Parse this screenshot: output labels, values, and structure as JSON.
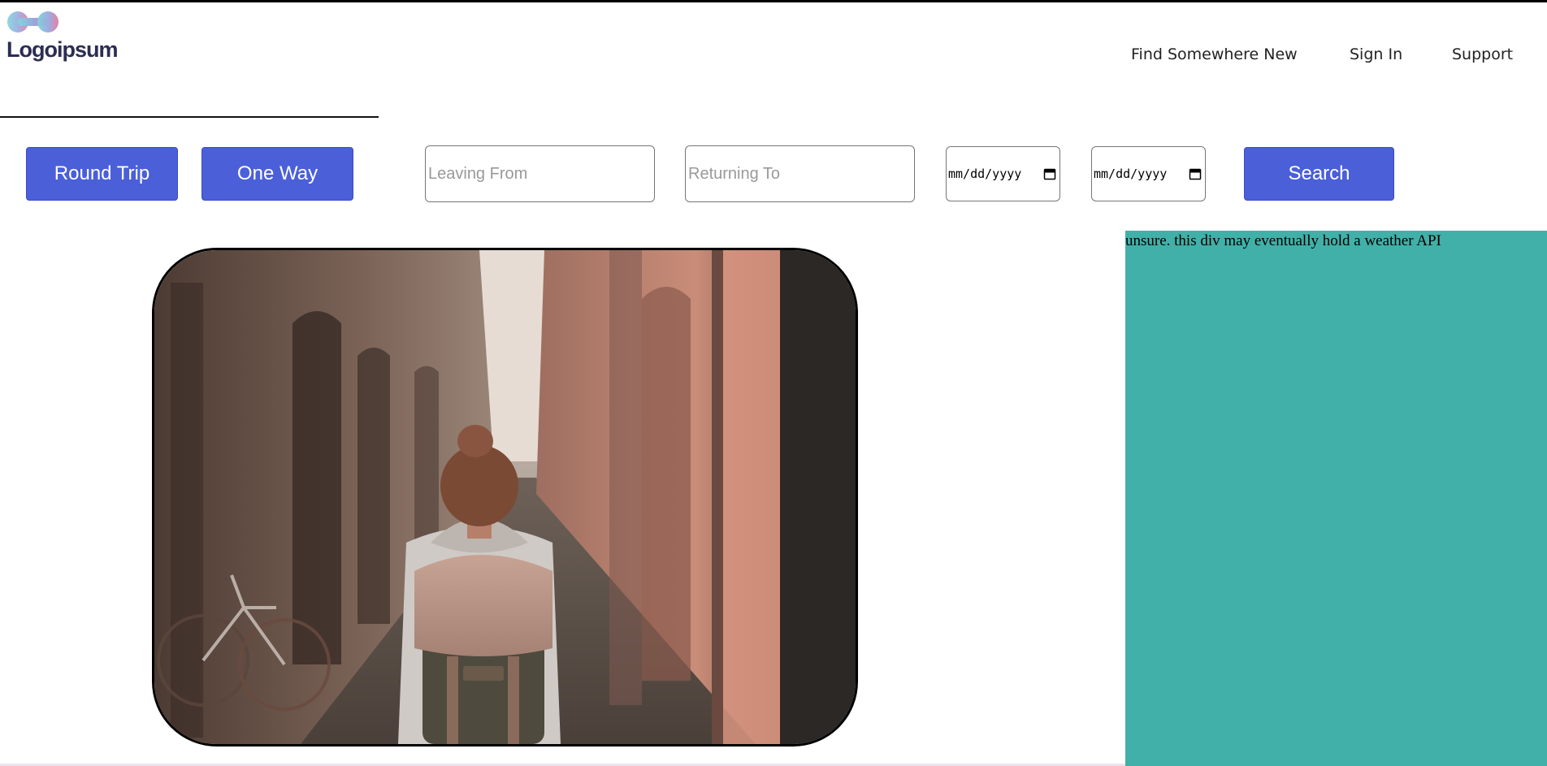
{
  "logo": {
    "text": "Logoipsum"
  },
  "nav": {
    "items": [
      {
        "label": "Find Somewhere New"
      },
      {
        "label": "Sign In"
      },
      {
        "label": "Support"
      }
    ]
  },
  "search_bar": {
    "round_trip_label": "Round Trip",
    "one_way_label": "One Way",
    "leaving_from_placeholder": "Leaving From",
    "returning_to_placeholder": "Returning To",
    "depart_date_value": "mm/dd/yyyy",
    "return_date_value": "mm/dd/yyyy",
    "search_label": "Search"
  },
  "weather_panel": {
    "text": "unsure. this div may eventually hold a weather API",
    "background": "#41b0a8"
  },
  "colors": {
    "button": "#4a5fd8",
    "logo_text": "#2b2d52"
  },
  "icons": {
    "calendar": "calendar-icon",
    "logo": "logo-mark-icon"
  }
}
